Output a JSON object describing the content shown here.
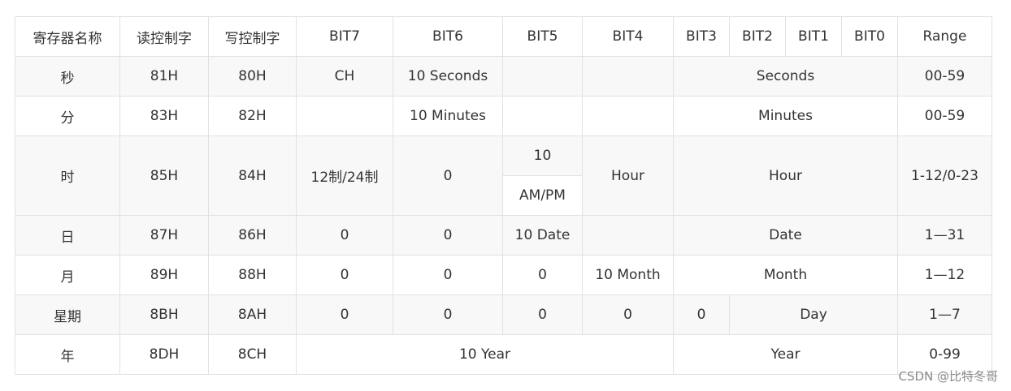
{
  "header": [
    "寄存器名称",
    "读控制字",
    "写控制字",
    "BIT7",
    "BIT6",
    "BIT5",
    "BIT4",
    "BIT3",
    "BIT2",
    "BIT1",
    "BIT0",
    "Range"
  ],
  "rows": {
    "sec": {
      "name": "秒",
      "read": "81H",
      "write": "80H",
      "bit7": "CH",
      "bit6": "10 Seconds",
      "bit5": "",
      "bit4": "",
      "low": "Seconds",
      "range": "00-59"
    },
    "min": {
      "name": "分",
      "read": "83H",
      "write": "82H",
      "bit7": "",
      "bit6": "10 Minutes",
      "bit5": "",
      "bit4": "",
      "low": "Minutes",
      "range": "00-59"
    },
    "hour": {
      "name": "时",
      "read": "85H",
      "write": "84H",
      "bit7": "12制/24制",
      "bit6": "0",
      "bit5_top": "10",
      "bit5_bottom": "AM/PM",
      "bit4": "Hour",
      "low": "Hour",
      "range": "1-12/0-23"
    },
    "date": {
      "name": "日",
      "read": "87H",
      "write": "86H",
      "bit7": "0",
      "bit6": "0",
      "bit5": "10 Date",
      "bit4": "",
      "low": "Date",
      "range": "1—31"
    },
    "month": {
      "name": "月",
      "read": "89H",
      "write": "88H",
      "bit7": "0",
      "bit6": "0",
      "bit5": "0",
      "bit4": "10 Month",
      "low": "Month",
      "range": "1—12"
    },
    "week": {
      "name": "星期",
      "read": "8BH",
      "write": "8AH",
      "bit7": "0",
      "bit6": "0",
      "bit5": "0",
      "bit4": "0",
      "bit3": "0",
      "low": "Day",
      "range": "1—7"
    },
    "year": {
      "name": "年",
      "read": "8DH",
      "write": "8CH",
      "high": "10 Year",
      "low": "Year",
      "range": "0-99"
    }
  },
  "watermark": "CSDN @比特冬哥"
}
